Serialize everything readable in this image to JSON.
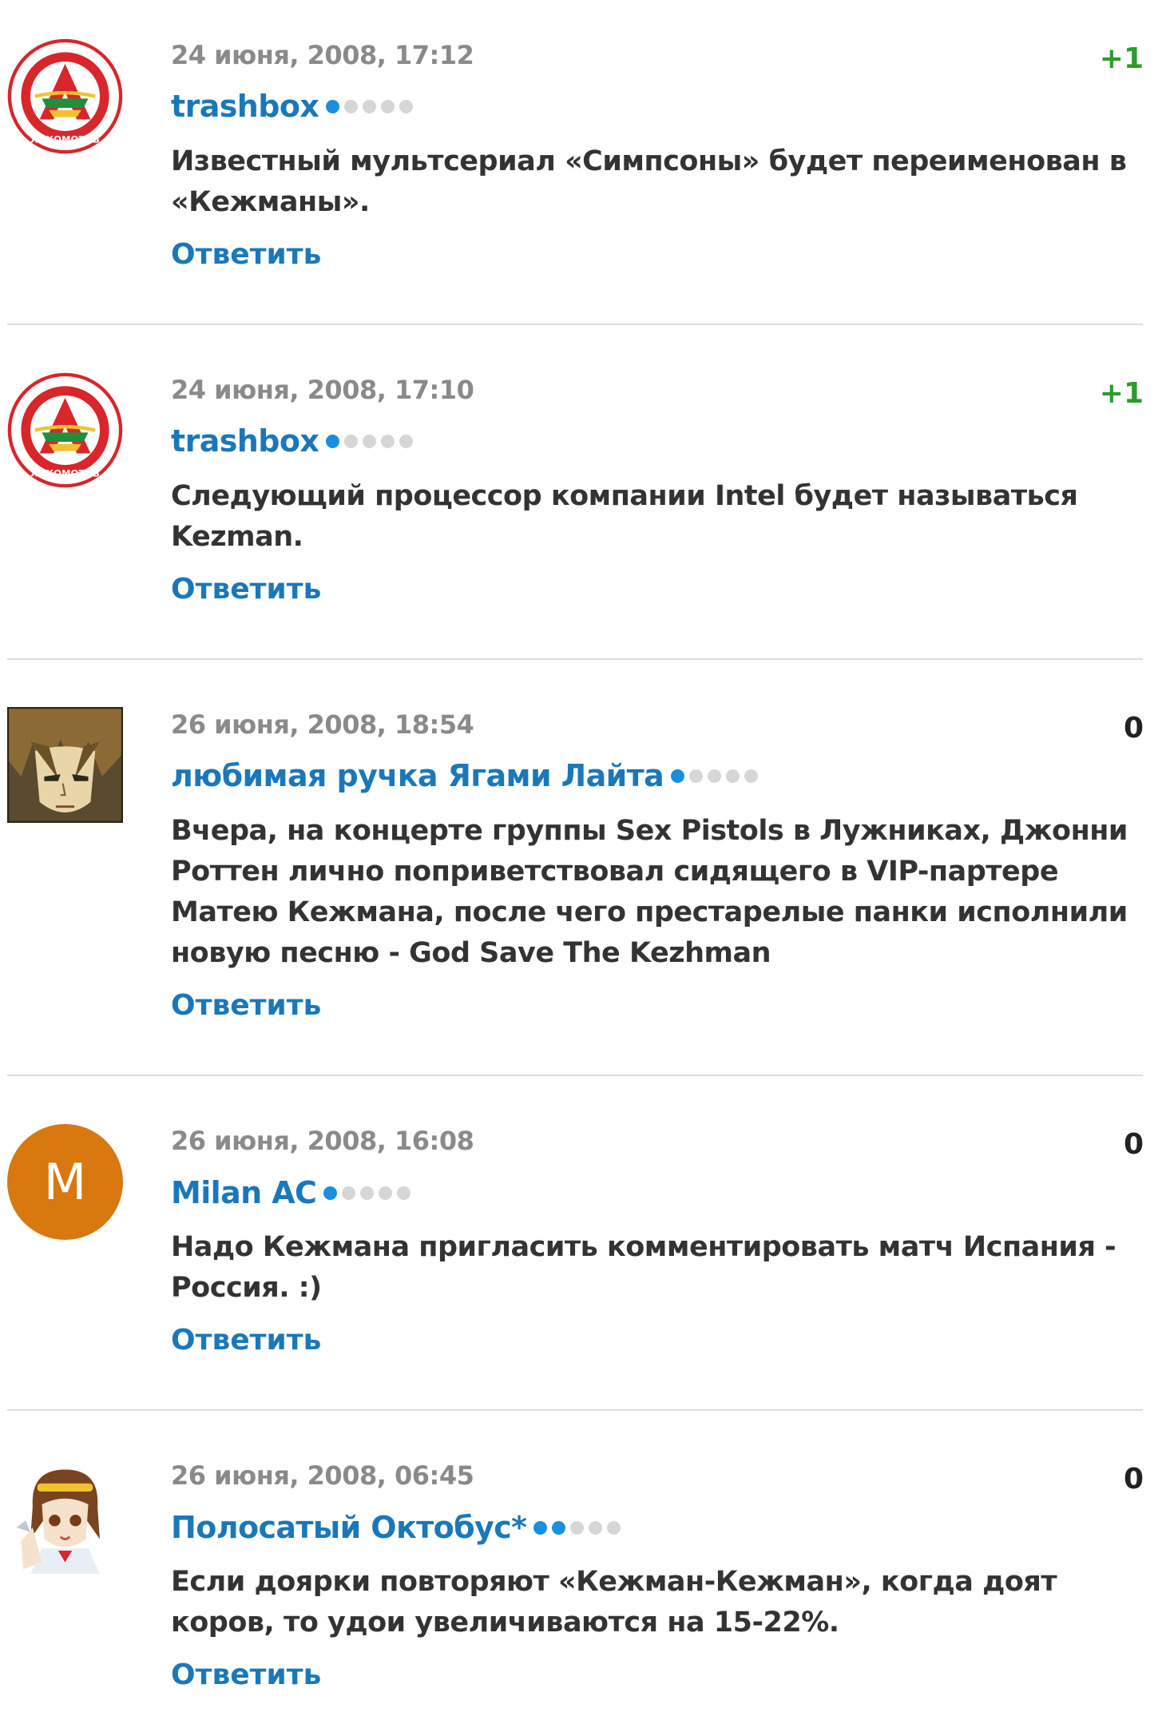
{
  "reply_label": "Ответить",
  "colors": {
    "author_link": "#1a78ba",
    "reply_link": "#1a78ba",
    "positive_rating": "#2a9d2a",
    "neutral_rating": "#222222",
    "dot_active": "#1a8ee0",
    "dot_inactive": "#d6d6d6"
  },
  "comments": [
    {
      "date": "24 июня, 2008, 17:12",
      "author": "trashbox",
      "reputation_level": 1,
      "reputation_max": 5,
      "rating": "+1",
      "text": "Известный мультсериал «Симпсоны» будет переименован в «Кежманы».",
      "avatar_icon": "lokomotiv-logo-icon"
    },
    {
      "date": "24 июня, 2008, 17:10",
      "author": "trashbox",
      "reputation_level": 1,
      "reputation_max": 5,
      "rating": "+1",
      "text": "Следующий процессор компании Intel будет называться Kezman.",
      "avatar_icon": "lokomotiv-logo-icon"
    },
    {
      "date": "26 июня, 2008, 18:54",
      "author": "любимая ручка Ягами Лайта",
      "reputation_level": 1,
      "reputation_max": 5,
      "rating": "0",
      "text": "Вчера, на концерте группы Sex Pistols в Лужниках, Джонни Роттен лично поприветствовал сидящего в VIP-партере Матею Кежмана, после чего престарелые панки исполнили новую песню - God Save The Kezhman",
      "avatar_icon": "anime-boy-avatar-icon"
    },
    {
      "date": "26 июня, 2008, 16:08",
      "author": "Milan AC",
      "reputation_level": 1,
      "reputation_max": 5,
      "rating": "0",
      "text": "Надо Кежмана пригласить комментировать матч Испания - Россия. :)",
      "avatar_icon": "letter-avatar-icon",
      "avatar_letter": "M",
      "avatar_color": "#d9780f"
    },
    {
      "date": "26 июня, 2008, 06:45",
      "author": "Полосатый Октобус*",
      "reputation_level": 2,
      "reputation_max": 5,
      "rating": "0",
      "text": "Если доярки повторяют «Кежман-Кежман», когда доят коров, то удои увеличиваются на 15-22%.",
      "avatar_icon": "anime-girl-avatar-icon"
    }
  ]
}
